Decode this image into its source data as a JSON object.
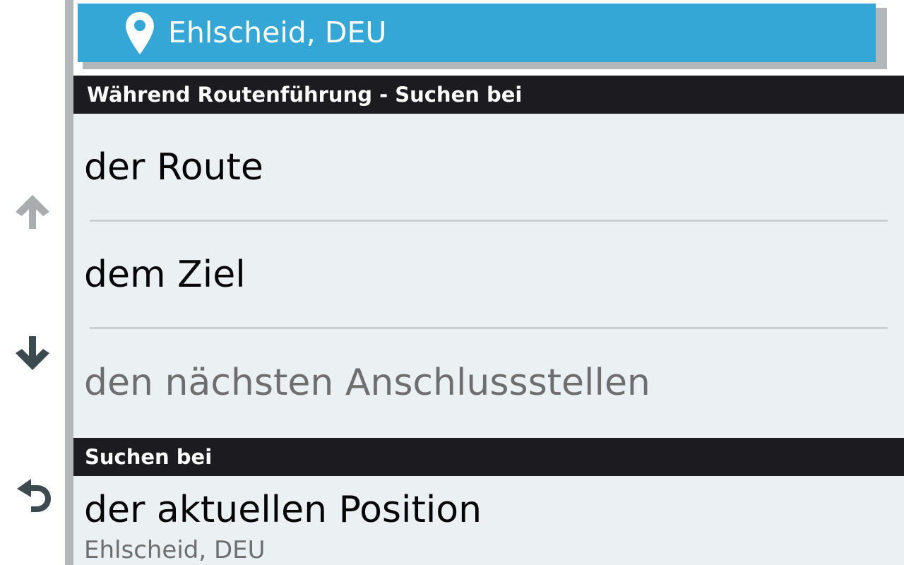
{
  "location": {
    "label": "Ehlscheid, DEU",
    "icon": "map-pin-icon",
    "bar_color": "#34a7d6"
  },
  "sections": {
    "during_navigation": {
      "header": "Während Routenführung - Suchen bei",
      "items": [
        {
          "label": "der Route",
          "enabled": true
        },
        {
          "label": "dem Ziel",
          "enabled": true
        },
        {
          "label": "den nächsten Anschlussstellen",
          "enabled": false
        }
      ]
    },
    "search_near": {
      "header": "Suchen bei",
      "items": [
        {
          "label": "der aktuellen Position",
          "sublabel": "Ehlscheid, DEU",
          "enabled": true
        }
      ]
    }
  },
  "sidebar": {
    "scroll_up_icon": "arrow-up-icon",
    "scroll_up_state": "disabled",
    "scroll_down_icon": "arrow-down-icon",
    "scroll_down_state": "enabled",
    "back_icon": "back-icon"
  },
  "colors": {
    "header_bg": "#1c1c20",
    "list_bg": "#ebf0f3",
    "disabled_text": "#6e6e6e",
    "icon_active": "#3b4a4f",
    "icon_disabled": "#a8acaf"
  }
}
